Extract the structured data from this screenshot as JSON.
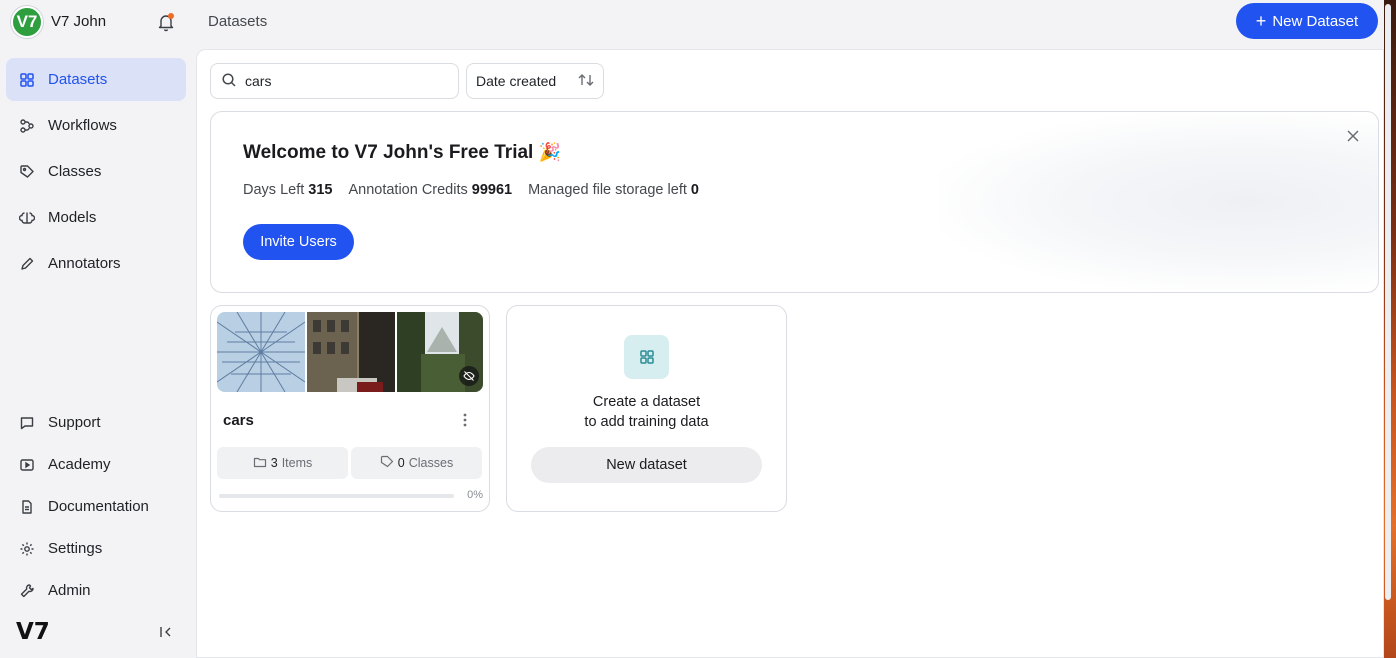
{
  "workspace": {
    "avatar_text": "V7",
    "name": "V7 John"
  },
  "header": {
    "breadcrumb": "Datasets",
    "new_button_label": "New Dataset"
  },
  "sidebar": {
    "items": [
      {
        "label": "Datasets",
        "icon": "grid-icon",
        "active": true
      },
      {
        "label": "Workflows",
        "icon": "workflow-icon"
      },
      {
        "label": "Classes",
        "icon": "tag-icon"
      },
      {
        "label": "Models",
        "icon": "brain-icon"
      },
      {
        "label": "Annotators",
        "icon": "pen-icon"
      }
    ],
    "bottom_items": [
      {
        "label": "Support",
        "icon": "chat-icon"
      },
      {
        "label": "Academy",
        "icon": "play-icon"
      },
      {
        "label": "Documentation",
        "icon": "document-icon"
      },
      {
        "label": "Settings",
        "icon": "gear-icon"
      },
      {
        "label": "Admin",
        "icon": "wrench-icon"
      }
    ],
    "logo_text": "V7"
  },
  "toolbar": {
    "search_value": "cars",
    "sort_label": "Date created"
  },
  "welcome": {
    "title": "Welcome to V7 John's Free Trial",
    "emoji": "🎉",
    "days_left_label": "Days Left",
    "days_left_value": "315",
    "credits_label": "Annotation Credits",
    "credits_value": "99961",
    "storage_label": "Managed file storage left",
    "storage_value": "0",
    "invite_label": "Invite Users"
  },
  "dataset_card": {
    "name": "cars",
    "items_count": "3",
    "items_label": "Items",
    "classes_count": "0",
    "classes_label": "Classes",
    "progress": 0,
    "progress_label": "0%"
  },
  "create_card": {
    "line1": "Create a dataset",
    "line2": "to add training data",
    "button_label": "New dataset"
  },
  "colors": {
    "accent": "#2153f0",
    "avatar": "#2e9e3f",
    "active_bg": "#dbe1f7"
  }
}
